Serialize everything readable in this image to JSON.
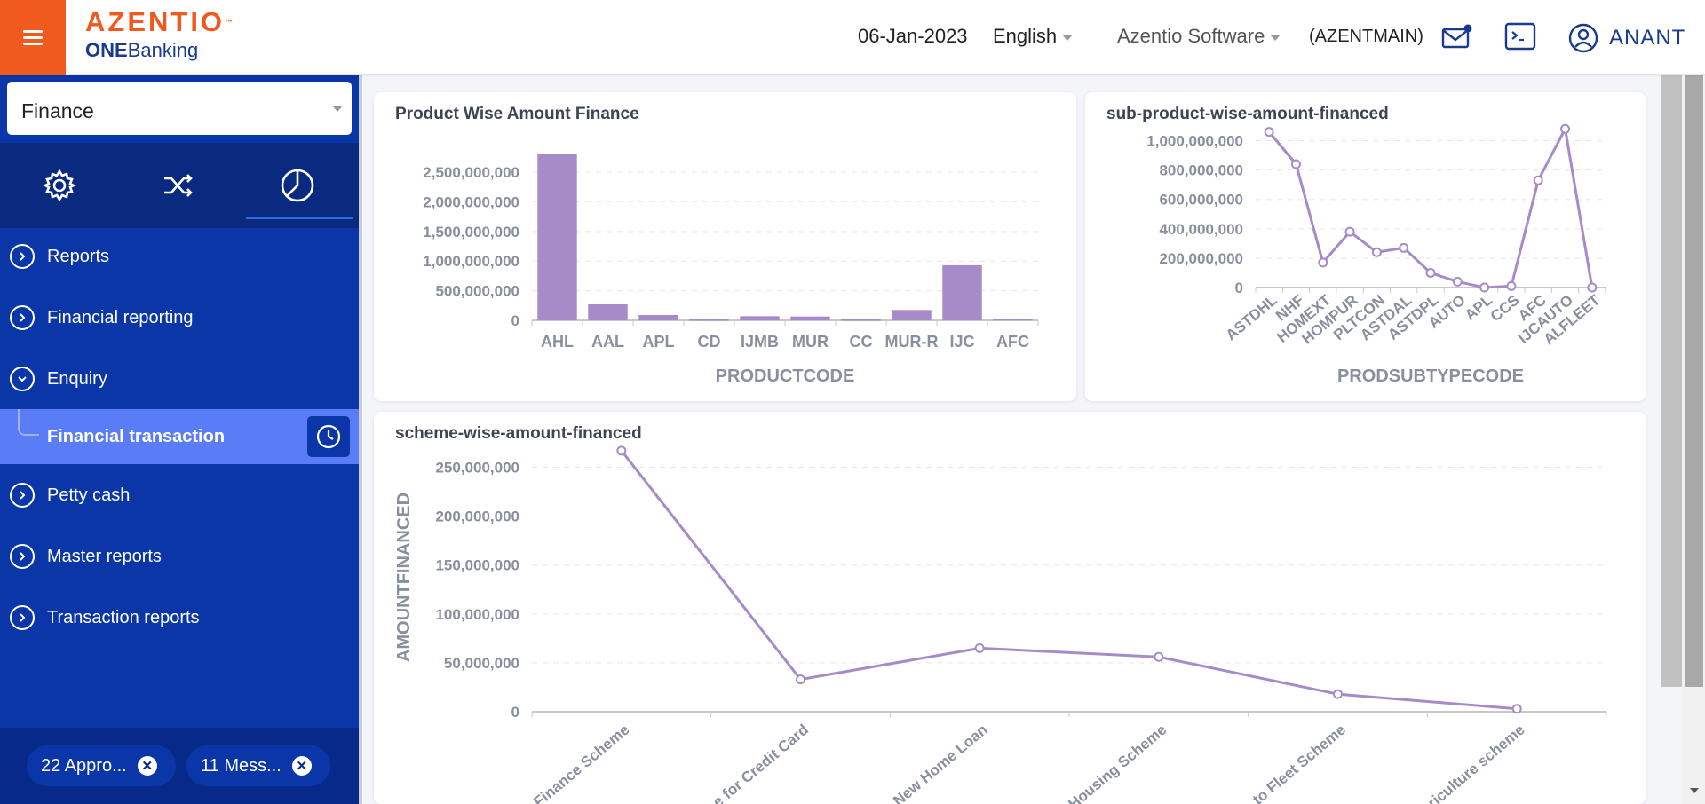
{
  "header": {
    "brand": "AZENTIO",
    "brand_tm": "™",
    "product_bold": "ONE",
    "product_rest": "Banking",
    "date": "06-Jan-2023",
    "language": "English",
    "company": "Azentio Software",
    "company_code": "(AZENTMAIN)",
    "user": "ANANT"
  },
  "sidebar": {
    "module": "Finance",
    "items": [
      {
        "label": "Reports"
      },
      {
        "label": "Financial reporting"
      },
      {
        "label": "Enquiry"
      },
      {
        "label": "Financial transaction"
      },
      {
        "label": "Petty cash"
      },
      {
        "label": "Master reports"
      },
      {
        "label": "Transaction reports"
      }
    ],
    "notifications": [
      {
        "label": "22 Appro..."
      },
      {
        "label": "11 Mess..."
      }
    ]
  },
  "colors": {
    "accent": "#f05a1e",
    "sidebar": "#0a36a8",
    "active": "#5a7cf7",
    "series": "#a68bc8"
  },
  "chart_data": [
    {
      "type": "bar",
      "title": "Product Wise Amount Finance",
      "xlabel": "PRODUCTCODE",
      "ylabel": "",
      "categories": [
        "AHL",
        "AAL",
        "APL",
        "CD",
        "IJMB",
        "MUR",
        "CC",
        "MUR-R",
        "IJC",
        "AFC"
      ],
      "values": [
        2800000000,
        270000000,
        90000000,
        15000000,
        70000000,
        65000000,
        15000000,
        175000000,
        930000000,
        20000000
      ],
      "ylim": [
        0,
        2800000000
      ],
      "ticks": [
        0,
        500000000,
        1000000000,
        1500000000,
        2000000000,
        2500000000
      ],
      "tick_labels": [
        "0",
        "500,000,000",
        "1,000,000,000",
        "1,500,000,000",
        "2,000,000,000",
        "2,500,000,000"
      ]
    },
    {
      "type": "line",
      "title": "sub-product-wise-amount-financed",
      "xlabel": "PRODSUBTYPECODE",
      "ylabel": "",
      "categories": [
        "ASTDHL",
        "NHF",
        "HOMEXT",
        "HOMPUR",
        "PLTCON",
        "ASTDAL",
        "ASTDPL",
        "AUTO",
        "APL",
        "CCS",
        "AFC",
        "IJCAUTO",
        "ALFLEET"
      ],
      "values": [
        1060000000,
        840000000,
        170000000,
        380000000,
        240000000,
        270000000,
        100000000,
        40000000,
        0,
        10000000,
        730000000,
        1080000000,
        0
      ],
      "ylim": [
        0,
        1100000000
      ],
      "ticks": [
        0,
        200000000,
        400000000,
        600000000,
        800000000,
        1000000000
      ],
      "tick_labels": [
        "0",
        "200,000,000",
        "400,000,000",
        "600,000,000",
        "800,000,000",
        "1,000,000,000"
      ]
    },
    {
      "type": "line",
      "title": "scheme-wise-amount-financed",
      "xlabel": "",
      "ylabel": "AMOUNTFINANCED",
      "categories": [
        "Finance Scheme",
        "e for Credit Card",
        "New Home Loan",
        "Housing Scheme",
        "to Fleet Scheme",
        "riculture scheme"
      ],
      "values": [
        267000000,
        33000000,
        65000000,
        56000000,
        18000000,
        3000000
      ],
      "ylim": [
        0,
        275000000
      ],
      "ticks": [
        0,
        50000000,
        100000000,
        150000000,
        200000000,
        250000000
      ],
      "tick_labels": [
        "0",
        "50,000,000",
        "100,000,000",
        "150,000,000",
        "200,000,000",
        "250,000,000"
      ]
    }
  ]
}
